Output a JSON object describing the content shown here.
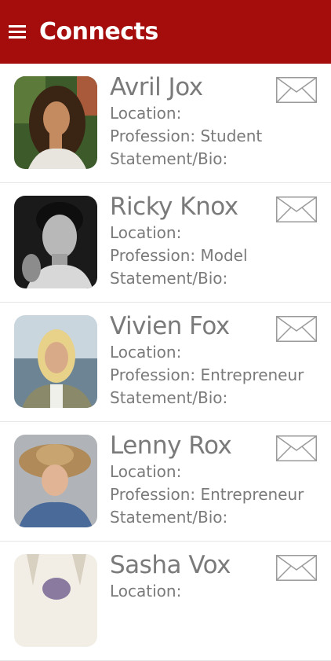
{
  "header": {
    "title": "Connects",
    "menu_icon": "hamburger-menu-icon",
    "color": "#a50c0c"
  },
  "labels": {
    "location": "Location:",
    "profession_prefix": "Profession:",
    "bio": "Statement/Bio:"
  },
  "contacts": [
    {
      "name": "Avril Jox",
      "profession": "Profession: Student"
    },
    {
      "name": "Ricky Knox",
      "profession": "Profession: Model"
    },
    {
      "name": "Vivien Fox",
      "profession": "Profession: Entrepreneur"
    },
    {
      "name": "Lenny Rox",
      "profession": "Profession: Entrepreneur"
    },
    {
      "name": "Sasha Vox",
      "profession": ""
    }
  ],
  "mail_icon": "envelope-icon"
}
